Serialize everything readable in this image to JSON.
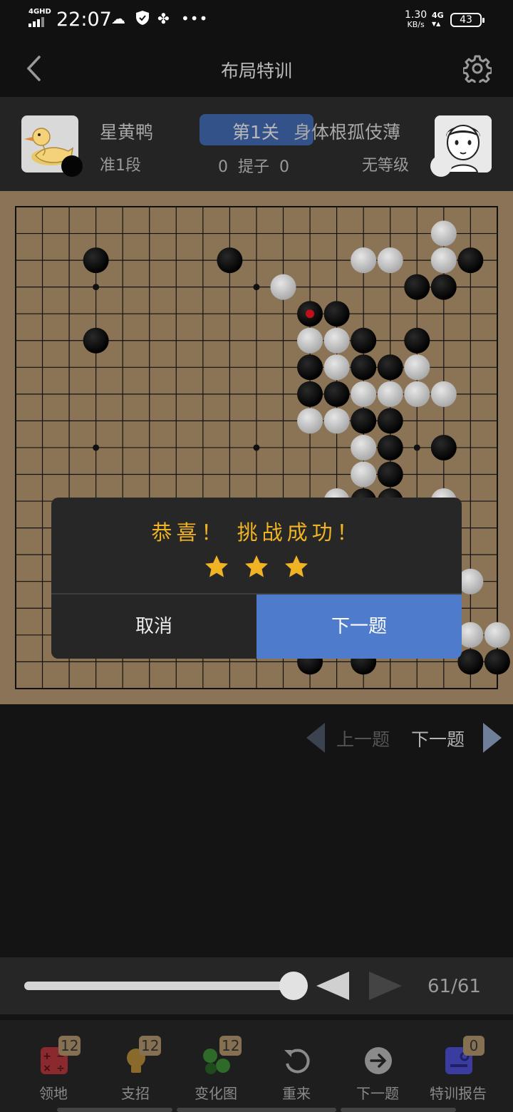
{
  "status_bar": {
    "network": "4GHD",
    "time": "22:07",
    "speed_value": "1.30",
    "speed_unit": "KB/s",
    "cell": "4G",
    "battery": "43"
  },
  "header": {
    "title": "布局特训",
    "back_icon": "chevron-left-icon",
    "settings_icon": "gear-icon"
  },
  "players": {
    "left": {
      "name": "星黄鸭",
      "rank": "准1段",
      "stone": "black"
    },
    "right": {
      "name": "身体根孤伎薄",
      "rank": "无等级",
      "stone": "white"
    },
    "level": "第1关",
    "captures": "0  提子  0"
  },
  "board": {
    "size": 19,
    "hoshi": [
      [
        3,
        3
      ],
      [
        9,
        3
      ],
      [
        15,
        3
      ],
      [
        3,
        9
      ],
      [
        9,
        9
      ],
      [
        15,
        9
      ],
      [
        3,
        15
      ],
      [
        9,
        15
      ],
      [
        15,
        15
      ]
    ],
    "last_move": [
      11,
      4
    ],
    "last_move_color": "#c0101a",
    "black": [
      [
        3,
        2
      ],
      [
        8,
        2
      ],
      [
        17,
        2
      ],
      [
        15,
        3
      ],
      [
        16,
        3
      ],
      [
        11,
        4
      ],
      [
        12,
        4
      ],
      [
        3,
        5
      ],
      [
        13,
        5
      ],
      [
        15,
        5
      ],
      [
        11,
        6
      ],
      [
        13,
        6
      ],
      [
        14,
        6
      ],
      [
        11,
        7
      ],
      [
        12,
        7
      ],
      [
        13,
        8
      ],
      [
        14,
        8
      ],
      [
        16,
        9
      ],
      [
        14,
        9
      ],
      [
        14,
        10
      ],
      [
        13,
        11
      ],
      [
        14,
        11
      ],
      [
        11,
        17
      ],
      [
        13,
        17
      ],
      [
        17,
        17
      ],
      [
        18,
        17
      ]
    ],
    "white": [
      [
        16,
        1
      ],
      [
        13,
        2
      ],
      [
        14,
        2
      ],
      [
        16,
        2
      ],
      [
        10,
        3
      ],
      [
        11,
        5
      ],
      [
        12,
        5
      ],
      [
        12,
        6
      ],
      [
        15,
        6
      ],
      [
        13,
        7
      ],
      [
        14,
        7
      ],
      [
        15,
        7
      ],
      [
        16,
        7
      ],
      [
        11,
        8
      ],
      [
        12,
        8
      ],
      [
        13,
        9
      ],
      [
        13,
        10
      ],
      [
        12,
        11
      ],
      [
        16,
        11
      ],
      [
        17,
        14
      ],
      [
        17,
        16
      ],
      [
        18,
        16
      ]
    ]
  },
  "nav": {
    "prev": "上一题",
    "next": "下一题"
  },
  "moves": {
    "counter": "61/61",
    "progress": 1.0
  },
  "tabs": [
    {
      "label": "领地",
      "badge": "12",
      "icon": "calculator-icon",
      "color": "#8a2a2e"
    },
    {
      "label": "支招",
      "badge": "12",
      "icon": "lightbulb-icon",
      "color": "#8a6a2a"
    },
    {
      "label": "变化图",
      "badge": "12",
      "icon": "variation-icon",
      "color": "#2e6a2a"
    },
    {
      "label": "重来",
      "badge": "",
      "icon": "restart-icon",
      "color": "#8a8a8a"
    },
    {
      "label": "下一题",
      "badge": "",
      "icon": "next-arrow-icon",
      "color": "#8a8a8a"
    },
    {
      "label": "特训报告",
      "badge": "0",
      "icon": "report-icon",
      "color": "#3b3ca0"
    }
  ],
  "dialog": {
    "title": "恭喜！ 挑战成功！",
    "stars": 3,
    "cancel": "取消",
    "next": "下一题",
    "star_color": "#f0b324",
    "primary_color": "#4e7bcc"
  }
}
